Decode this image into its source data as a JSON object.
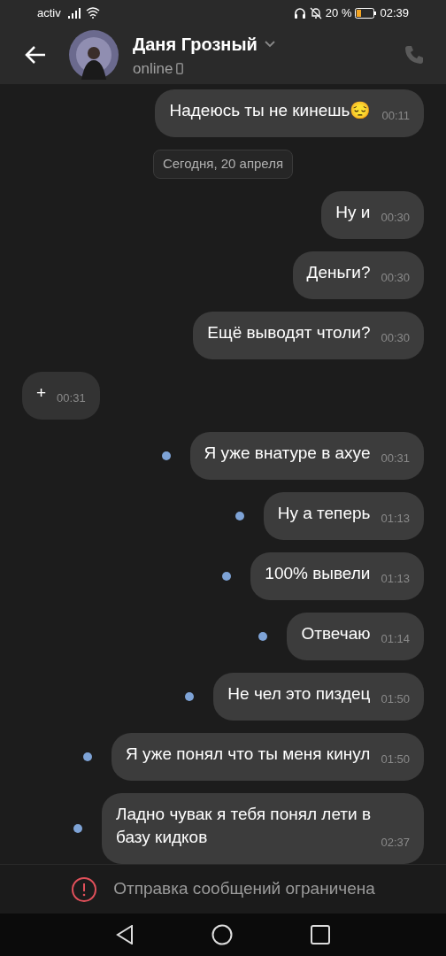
{
  "status_bar": {
    "carrier": "activ",
    "battery": "20 %",
    "time": "02:39"
  },
  "header": {
    "name": "Даня Грозный",
    "status": "online"
  },
  "date_pill": "Сегодня, 20 апреля",
  "messages": [
    {
      "outgoing": true,
      "text": "Надеюсь ты не кинешь😔",
      "time": "00:11",
      "unread": false
    },
    {
      "outgoing": true,
      "text": "Ну и",
      "time": "00:30",
      "unread": false
    },
    {
      "outgoing": true,
      "text": "Деньги?",
      "time": "00:30",
      "unread": false
    },
    {
      "outgoing": true,
      "text": "Ещё выводят чтоли?",
      "time": "00:30",
      "unread": false
    },
    {
      "outgoing": false,
      "text": "+",
      "time": "00:31",
      "unread": false
    },
    {
      "outgoing": true,
      "text": "Я уже внатуре в ахуе",
      "time": "00:31",
      "unread": true
    },
    {
      "outgoing": true,
      "text": "Ну а теперь",
      "time": "01:13",
      "unread": true
    },
    {
      "outgoing": true,
      "text": "100% вывели",
      "time": "01:13",
      "unread": true
    },
    {
      "outgoing": true,
      "text": "Отвечаю",
      "time": "01:14",
      "unread": true
    },
    {
      "outgoing": true,
      "text": "Не чел это пиздец",
      "time": "01:50",
      "unread": true
    },
    {
      "outgoing": true,
      "text": "Я уже понял что ты меня кинул",
      "time": "01:50",
      "unread": true
    },
    {
      "outgoing": true,
      "text": "Ладно чувак я тебя понял лети в базу кидков",
      "time": "02:37",
      "unread": true
    }
  ],
  "notice": "Отправка сообщений ограничена"
}
